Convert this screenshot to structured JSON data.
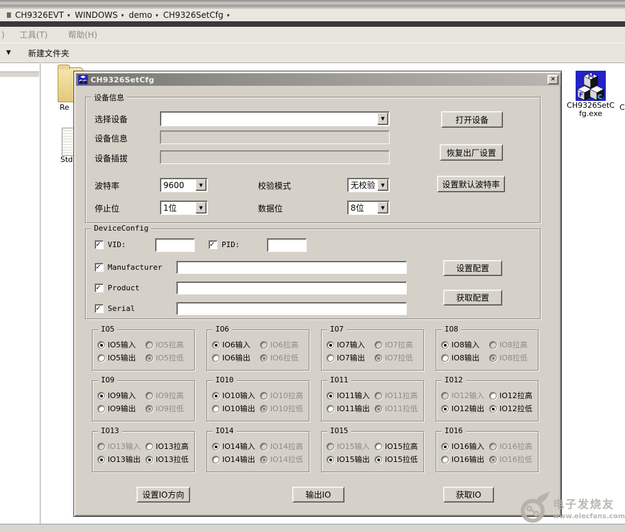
{
  "icons": {
    "chevron_down": "▼",
    "breadcrumb_arrow": "▾",
    "toolbar_dropdown": "▼",
    "close": "✕",
    "checkbox_check": "✓"
  },
  "explorer": {
    "breadcrumb": [
      "CH9326EVT",
      "WINDOWS",
      "demo",
      "CH9326SetCfg"
    ],
    "menu_prefix": ")",
    "menus": [
      "工具(T)",
      "帮助(H)"
    ],
    "toolbar": {
      "new_folder": "新建文件夹"
    },
    "files": [
      {
        "label": "Re"
      },
      {
        "label": "Std"
      }
    ],
    "clipped_label": "C"
  },
  "dialog": {
    "title": "CH9326SetCfg",
    "device_info": {
      "group_label": "设备信息",
      "select_device_label": "选择设备",
      "select_device_value": "",
      "device_info_label": "设备信息",
      "device_info_value": "",
      "device_plug_label": "设备插拔",
      "device_plug_value": "",
      "baud_label": "波特率",
      "baud_value": "9600",
      "parity_label": "校验模式",
      "parity_value": "无校验",
      "stop_label": "停止位",
      "stop_value": "1位",
      "data_label": "数据位",
      "data_value": "8位",
      "open_device_btn": "打开设备",
      "factory_reset_btn": "恢复出厂设置",
      "default_baud_btn": "设置默认波特率"
    },
    "device_config": {
      "group_label": "DeviceConfig",
      "vid_label": "VID:",
      "vid_value": "",
      "pid_label": "PID:",
      "pid_value": "",
      "manufacturer_label": "Manufacturer",
      "manufacturer_value": "",
      "product_label": "Product",
      "product_value": "",
      "serial_label": "Serial",
      "serial_value": "",
      "set_config_btn": "设置配置",
      "get_config_btn": "获取配置"
    },
    "io_groups": [
      {
        "name": "IO5",
        "options": [
          {
            "label": "IO5输入",
            "checked": true,
            "enabled": true
          },
          {
            "label": "IO5拉高",
            "checked": false,
            "enabled": false
          },
          {
            "label": "IO5输出",
            "checked": false,
            "enabled": true
          },
          {
            "label": "IO5拉低",
            "checked": true,
            "enabled": false
          }
        ]
      },
      {
        "name": "IO6",
        "options": [
          {
            "label": "IO6输入",
            "checked": true,
            "enabled": true
          },
          {
            "label": "IO6拉高",
            "checked": false,
            "enabled": false
          },
          {
            "label": "IO6输出",
            "checked": false,
            "enabled": true
          },
          {
            "label": "IO6拉低",
            "checked": true,
            "enabled": false
          }
        ]
      },
      {
        "name": "IO7",
        "options": [
          {
            "label": "IO7输入",
            "checked": true,
            "enabled": true
          },
          {
            "label": "IO7拉高",
            "checked": false,
            "enabled": false
          },
          {
            "label": "IO7输出",
            "checked": false,
            "enabled": true
          },
          {
            "label": "IO7拉低",
            "checked": true,
            "enabled": false
          }
        ]
      },
      {
        "name": "IO8",
        "options": [
          {
            "label": "IO8输入",
            "checked": true,
            "enabled": true
          },
          {
            "label": "IO8拉高",
            "checked": false,
            "enabled": false
          },
          {
            "label": "IO8输出",
            "checked": false,
            "enabled": true
          },
          {
            "label": "IO8拉低",
            "checked": true,
            "enabled": false
          }
        ]
      },
      {
        "name": "IO9",
        "options": [
          {
            "label": "IO9输入",
            "checked": true,
            "enabled": true
          },
          {
            "label": "IO9拉高",
            "checked": false,
            "enabled": false
          },
          {
            "label": "IO9输出",
            "checked": false,
            "enabled": true
          },
          {
            "label": "IO9拉低",
            "checked": true,
            "enabled": false
          }
        ]
      },
      {
        "name": "IO10",
        "options": [
          {
            "label": "IO10输入",
            "checked": true,
            "enabled": true
          },
          {
            "label": "IO10拉高",
            "checked": false,
            "enabled": false
          },
          {
            "label": "IO10输出",
            "checked": false,
            "enabled": true
          },
          {
            "label": "IO10拉低",
            "checked": true,
            "enabled": false
          }
        ]
      },
      {
        "name": "IO11",
        "options": [
          {
            "label": "IO11输入",
            "checked": true,
            "enabled": true
          },
          {
            "label": "IO11拉高",
            "checked": false,
            "enabled": false
          },
          {
            "label": "IO11输出",
            "checked": false,
            "enabled": true
          },
          {
            "label": "IO11拉低",
            "checked": true,
            "enabled": false
          }
        ]
      },
      {
        "name": "IO12",
        "options": [
          {
            "label": "IO12输入",
            "checked": false,
            "enabled": false
          },
          {
            "label": "IO12拉高",
            "checked": false,
            "enabled": true
          },
          {
            "label": "IO12输出",
            "checked": true,
            "enabled": true
          },
          {
            "label": "IO12拉低",
            "checked": true,
            "enabled": true
          }
        ]
      },
      {
        "name": "IO13",
        "options": [
          {
            "label": "IO13输入",
            "checked": false,
            "enabled": false
          },
          {
            "label": "IO13拉高",
            "checked": false,
            "enabled": true
          },
          {
            "label": "IO13输出",
            "checked": true,
            "enabled": true
          },
          {
            "label": "IO13拉低",
            "checked": true,
            "enabled": true
          }
        ]
      },
      {
        "name": "IO14",
        "options": [
          {
            "label": "IO14输入",
            "checked": true,
            "enabled": true
          },
          {
            "label": "IO14拉高",
            "checked": false,
            "enabled": false
          },
          {
            "label": "IO14输出",
            "checked": false,
            "enabled": true
          },
          {
            "label": "IO14拉低",
            "checked": true,
            "enabled": false
          }
        ]
      },
      {
        "name": "IO15",
        "options": [
          {
            "label": "IO15输入",
            "checked": false,
            "enabled": false
          },
          {
            "label": "IO15拉高",
            "checked": false,
            "enabled": true
          },
          {
            "label": "IO15输出",
            "checked": true,
            "enabled": true
          },
          {
            "label": "IO15拉低",
            "checked": true,
            "enabled": true
          }
        ]
      },
      {
        "name": "IO16",
        "options": [
          {
            "label": "IO16输入",
            "checked": true,
            "enabled": true
          },
          {
            "label": "IO16拉高",
            "checked": false,
            "enabled": false
          },
          {
            "label": "IO16输出",
            "checked": false,
            "enabled": true
          },
          {
            "label": "IO16拉低",
            "checked": true,
            "enabled": false
          }
        ]
      }
    ],
    "footer": {
      "set_io_dir_btn": "设置IO方向",
      "output_io_btn": "输出IO",
      "get_io_btn": "获取IO"
    }
  },
  "desktop_icon": {
    "line1": "CH9326SetC",
    "line2": "fg.exe"
  },
  "watermark": {
    "title": "电子发烧友",
    "url": "www.elecfans.com"
  }
}
